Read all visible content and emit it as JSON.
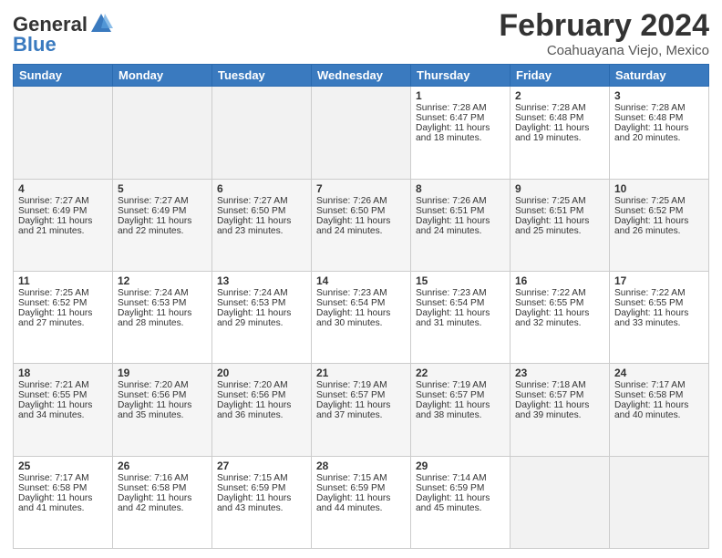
{
  "header": {
    "logo_line1": "General",
    "logo_line2": "Blue",
    "main_title": "February 2024",
    "sub_title": "Coahuayana Viejo, Mexico"
  },
  "days_of_week": [
    "Sunday",
    "Monday",
    "Tuesday",
    "Wednesday",
    "Thursday",
    "Friday",
    "Saturday"
  ],
  "weeks": [
    [
      {
        "day": "",
        "info": ""
      },
      {
        "day": "",
        "info": ""
      },
      {
        "day": "",
        "info": ""
      },
      {
        "day": "",
        "info": ""
      },
      {
        "day": "1",
        "info": "Sunrise: 7:28 AM\nSunset: 6:47 PM\nDaylight: 11 hours and 18 minutes."
      },
      {
        "day": "2",
        "info": "Sunrise: 7:28 AM\nSunset: 6:48 PM\nDaylight: 11 hours and 19 minutes."
      },
      {
        "day": "3",
        "info": "Sunrise: 7:28 AM\nSunset: 6:48 PM\nDaylight: 11 hours and 20 minutes."
      }
    ],
    [
      {
        "day": "4",
        "info": "Sunrise: 7:27 AM\nSunset: 6:49 PM\nDaylight: 11 hours and 21 minutes."
      },
      {
        "day": "5",
        "info": "Sunrise: 7:27 AM\nSunset: 6:49 PM\nDaylight: 11 hours and 22 minutes."
      },
      {
        "day": "6",
        "info": "Sunrise: 7:27 AM\nSunset: 6:50 PM\nDaylight: 11 hours and 23 minutes."
      },
      {
        "day": "7",
        "info": "Sunrise: 7:26 AM\nSunset: 6:50 PM\nDaylight: 11 hours and 24 minutes."
      },
      {
        "day": "8",
        "info": "Sunrise: 7:26 AM\nSunset: 6:51 PM\nDaylight: 11 hours and 24 minutes."
      },
      {
        "day": "9",
        "info": "Sunrise: 7:25 AM\nSunset: 6:51 PM\nDaylight: 11 hours and 25 minutes."
      },
      {
        "day": "10",
        "info": "Sunrise: 7:25 AM\nSunset: 6:52 PM\nDaylight: 11 hours and 26 minutes."
      }
    ],
    [
      {
        "day": "11",
        "info": "Sunrise: 7:25 AM\nSunset: 6:52 PM\nDaylight: 11 hours and 27 minutes."
      },
      {
        "day": "12",
        "info": "Sunrise: 7:24 AM\nSunset: 6:53 PM\nDaylight: 11 hours and 28 minutes."
      },
      {
        "day": "13",
        "info": "Sunrise: 7:24 AM\nSunset: 6:53 PM\nDaylight: 11 hours and 29 minutes."
      },
      {
        "day": "14",
        "info": "Sunrise: 7:23 AM\nSunset: 6:54 PM\nDaylight: 11 hours and 30 minutes."
      },
      {
        "day": "15",
        "info": "Sunrise: 7:23 AM\nSunset: 6:54 PM\nDaylight: 11 hours and 31 minutes."
      },
      {
        "day": "16",
        "info": "Sunrise: 7:22 AM\nSunset: 6:55 PM\nDaylight: 11 hours and 32 minutes."
      },
      {
        "day": "17",
        "info": "Sunrise: 7:22 AM\nSunset: 6:55 PM\nDaylight: 11 hours and 33 minutes."
      }
    ],
    [
      {
        "day": "18",
        "info": "Sunrise: 7:21 AM\nSunset: 6:55 PM\nDaylight: 11 hours and 34 minutes."
      },
      {
        "day": "19",
        "info": "Sunrise: 7:20 AM\nSunset: 6:56 PM\nDaylight: 11 hours and 35 minutes."
      },
      {
        "day": "20",
        "info": "Sunrise: 7:20 AM\nSunset: 6:56 PM\nDaylight: 11 hours and 36 minutes."
      },
      {
        "day": "21",
        "info": "Sunrise: 7:19 AM\nSunset: 6:57 PM\nDaylight: 11 hours and 37 minutes."
      },
      {
        "day": "22",
        "info": "Sunrise: 7:19 AM\nSunset: 6:57 PM\nDaylight: 11 hours and 38 minutes."
      },
      {
        "day": "23",
        "info": "Sunrise: 7:18 AM\nSunset: 6:57 PM\nDaylight: 11 hours and 39 minutes."
      },
      {
        "day": "24",
        "info": "Sunrise: 7:17 AM\nSunset: 6:58 PM\nDaylight: 11 hours and 40 minutes."
      }
    ],
    [
      {
        "day": "25",
        "info": "Sunrise: 7:17 AM\nSunset: 6:58 PM\nDaylight: 11 hours and 41 minutes."
      },
      {
        "day": "26",
        "info": "Sunrise: 7:16 AM\nSunset: 6:58 PM\nDaylight: 11 hours and 42 minutes."
      },
      {
        "day": "27",
        "info": "Sunrise: 7:15 AM\nSunset: 6:59 PM\nDaylight: 11 hours and 43 minutes."
      },
      {
        "day": "28",
        "info": "Sunrise: 7:15 AM\nSunset: 6:59 PM\nDaylight: 11 hours and 44 minutes."
      },
      {
        "day": "29",
        "info": "Sunrise: 7:14 AM\nSunset: 6:59 PM\nDaylight: 11 hours and 45 minutes."
      },
      {
        "day": "",
        "info": ""
      },
      {
        "day": "",
        "info": ""
      }
    ]
  ]
}
